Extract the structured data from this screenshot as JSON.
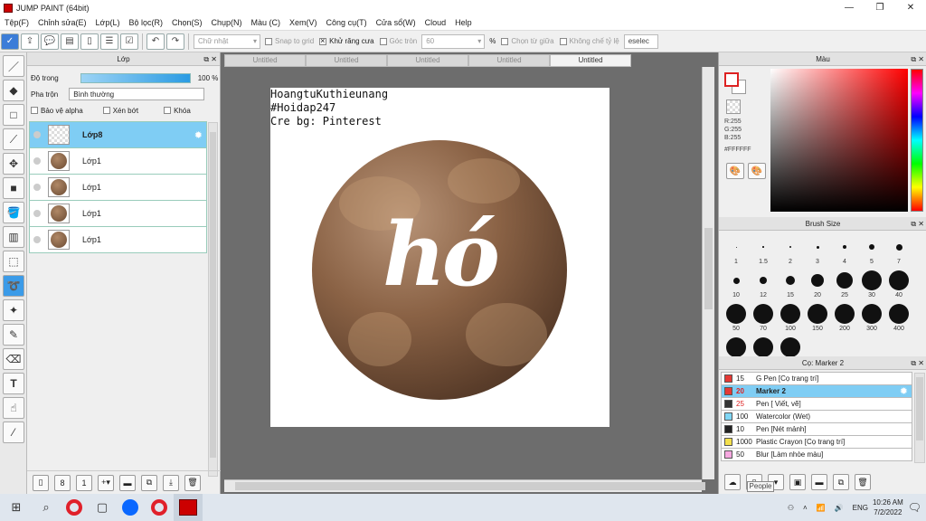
{
  "window": {
    "title": "JUMP PAINT (64bit)",
    "min": "—",
    "max": "❐",
    "close": "✕"
  },
  "menu": [
    "Tệp(F)",
    "Chỉnh sửa(E)",
    "Lớp(L)",
    "Bộ lọc(R)",
    "Chọn(S)",
    "Chụp(N)",
    "Màu (C)",
    "Xem(V)",
    "Công cụ(T)",
    "Cửa sổ(W)",
    "Cloud",
    "Help"
  ],
  "toolbar": {
    "shape_select": "Chữ nhật",
    "snap_label": "Snap to grid",
    "antialias_label": "Khử răng cưa",
    "round_label": "Góc tròn",
    "round_value": "60",
    "percent": "%",
    "from_center_label": "Chọn từ giữa",
    "no_ratio_label": "Không chế tỷ lệ",
    "deselect_label": "eselec"
  },
  "layer_panel": {
    "title": "Lớp",
    "opacity_label": "Độ trong",
    "opacity_value": "100 %",
    "opacity_level": 1.0,
    "blend_label": "Pha trộn",
    "blend_value": "Bình thường",
    "protect_alpha": "Bảo vệ alpha",
    "clip": "Xén bớt",
    "lock": "Khóa",
    "layers": [
      {
        "name": "Lớp8",
        "selected": true
      },
      {
        "name": "Lớp1",
        "selected": false
      },
      {
        "name": "Lớp1",
        "selected": false
      },
      {
        "name": "Lớp1",
        "selected": false
      },
      {
        "name": "Lớp1",
        "selected": false
      }
    ]
  },
  "tabs": [
    "Untitled",
    "Untitled",
    "Untitled",
    "Untitled",
    "Untitled"
  ],
  "canvas": {
    "caption": [
      "HoangtuKuthieunang",
      "#Hoidap247",
      "Cre bg: Pinterest"
    ],
    "big_text": "hó"
  },
  "color_panel": {
    "title": "Màu",
    "r": "R:255",
    "g": "G:255",
    "b": "B:255",
    "hex": "#FFFFFF",
    "accent": "#ff0000"
  },
  "brush_panel": {
    "title": "Brush Size",
    "sizes": [
      "1",
      "1.5",
      "2",
      "3",
      "4",
      "5",
      "7",
      "10",
      "12",
      "15",
      "20",
      "25",
      "30",
      "40",
      "50",
      "70",
      "100",
      "150",
      "200",
      "300",
      "400",
      "",
      "",
      ""
    ]
  },
  "sub_panel": {
    "title": "Cọ: Marker 2",
    "items": [
      {
        "size": "15",
        "name": "G Pen [Cọ trang trí]",
        "color": "#e53935"
      },
      {
        "size": "20",
        "name": "Marker 2",
        "color": "#e53935",
        "selected": true
      },
      {
        "size": "25",
        "name": "Pen [ Viết, vẽ]",
        "color": "#333333"
      },
      {
        "size": "100",
        "name": "Watercolor (Wet)",
        "color": "#7fd6f5"
      },
      {
        "size": "10",
        "name": "Pen [Nét mảnh]",
        "color": "#222222"
      },
      {
        "size": "1000",
        "name": "Plastic Crayon [Cọ trang trí]",
        "color": "#f4e04d"
      },
      {
        "size": "50",
        "name": "Blur [Làm nhòe màu]",
        "color": "#f6a8e0"
      }
    ]
  },
  "tooltip": "People",
  "taskbar": {
    "lang": "ENG",
    "time": "10:26 AM",
    "date": "7/2/2022"
  }
}
